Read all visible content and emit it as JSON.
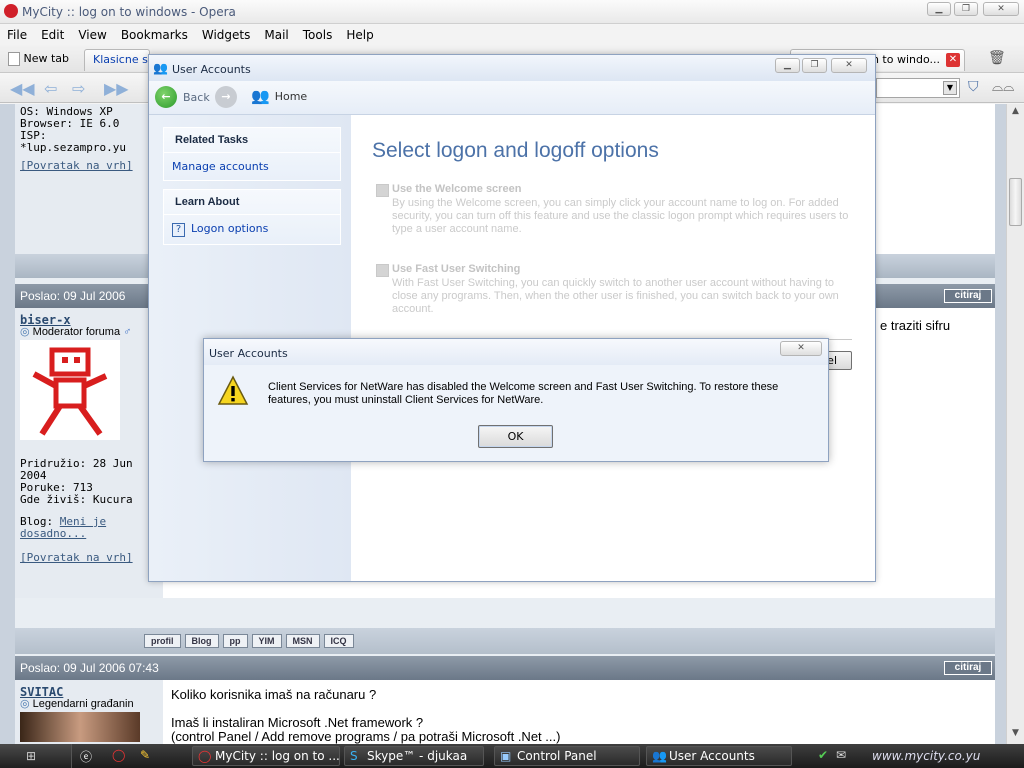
{
  "browser": {
    "title": "MyCity :: log on to windows - Opera",
    "menu": [
      "File",
      "Edit",
      "View",
      "Bookmarks",
      "Widgets",
      "Mail",
      "Tools",
      "Help"
    ],
    "new_tab_label": "New tab",
    "tabs": [
      "Klasicne s",
      "on to windo..."
    ]
  },
  "forum": {
    "post1": {
      "os": "OS: Windows XP",
      "browser": "Browser: IE 6.0",
      "isp": "ISP:",
      "isp_val": "*lup.sezampro.yu",
      "back_link": "[Povratak na vrh]"
    },
    "post2": {
      "header": "Poslao: 09 Jul 2006",
      "cite": "citiraj",
      "user": "biser-x",
      "rank": "Moderator foruma",
      "joined": "Pridružio: 28 Jun 2004",
      "posts": "Poruke: 713",
      "location": "Gde živiš: Kucura",
      "blog_label": "Blog:",
      "blog_link1": "Meni je",
      "blog_link2": "dosadno...",
      "back_link": "[Povratak na vrh]",
      "text_snippet": "e traziti sifru",
      "sig_dots": ". . ."
    },
    "buttons": [
      "profil",
      "Blog",
      "pp",
      "YIM",
      "MSN",
      "ICQ"
    ],
    "post3": {
      "header": "Poslao: 09 Jul 2006 07:43",
      "cite": "citiraj",
      "user": "SVITAC",
      "rank": "Legendarni građanin",
      "line1": "Koliko korisnika imaš na računaru ?",
      "line2": "Imaš li instaliran Microsoft .Net framework ?",
      "line3": "(control Panel / Add remove programs / pa potraši Microsoft .Net ...)"
    }
  },
  "ua": {
    "title": "User Accounts",
    "back": "Back",
    "home": "Home",
    "related_tasks": "Related Tasks",
    "manage_accounts": "Manage accounts",
    "learn_about": "Learn About",
    "logon_options": "Logon options",
    "heading": "Select logon and logoff options",
    "opt1_label": "Use the Welcome screen",
    "opt1_desc": "By using the Welcome screen, you can simply click your account name to log on. For added security, you can turn off this feature and use the classic logon prompt which requires users to type a user account name.",
    "opt2_label": "Use Fast User Switching",
    "opt2_desc": "With Fast User Switching, you can quickly switch to another user account without having to close any programs. Then, when the other user is finished, you can switch back to your own account.",
    "cancel_partial": "el"
  },
  "dialog": {
    "title": "User Accounts",
    "message": "Client Services for NetWare has disabled the Welcome screen and Fast User Switching. To restore these features, you must uninstall Client Services for NetWare.",
    "ok": "OK"
  },
  "taskbar": {
    "tasks": [
      "MyCity :: log on to ...",
      "Skype™ - djukaa",
      "Control Panel",
      "User Accounts"
    ],
    "tray_text": "www.mycity.co.yu"
  }
}
